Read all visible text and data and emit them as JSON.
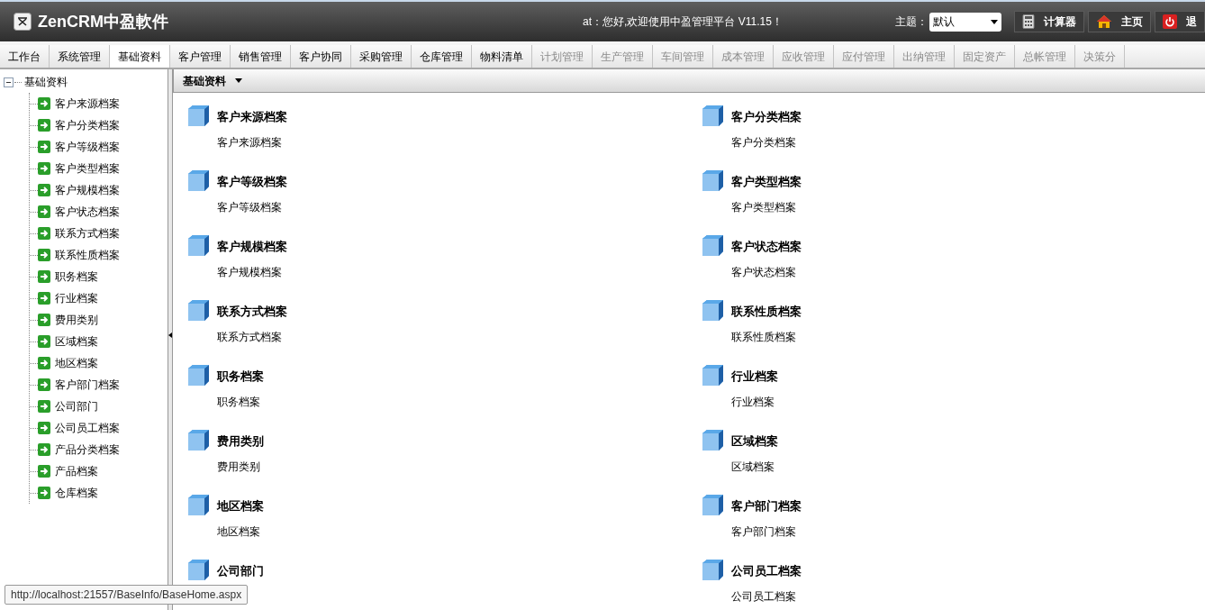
{
  "header": {
    "logo_text": "ZenCRM中盈軟件",
    "greeting": "at：您好,欢迎使用中盈管理平台 V11.15！",
    "theme": {
      "label": "主题：",
      "value": "默认"
    },
    "buttons": [
      {
        "kind": "calculator",
        "label": "计算器"
      },
      {
        "kind": "home",
        "label": "主页"
      },
      {
        "kind": "power",
        "label": "退"
      }
    ]
  },
  "tabs": [
    {
      "label": "工作台",
      "selected": false,
      "disabled": false
    },
    {
      "label": "系统管理",
      "selected": false,
      "disabled": false
    },
    {
      "label": "基础资料",
      "selected": true,
      "disabled": false
    },
    {
      "label": "客户管理",
      "selected": false,
      "disabled": false
    },
    {
      "label": "销售管理",
      "selected": false,
      "disabled": false
    },
    {
      "label": "客户协同",
      "selected": false,
      "disabled": false
    },
    {
      "label": "采购管理",
      "selected": false,
      "disabled": false
    },
    {
      "label": "仓库管理",
      "selected": false,
      "disabled": false
    },
    {
      "label": "物料清单",
      "selected": false,
      "disabled": false
    },
    {
      "label": "计划管理",
      "selected": false,
      "disabled": true
    },
    {
      "label": "生产管理",
      "selected": false,
      "disabled": true
    },
    {
      "label": "车间管理",
      "selected": false,
      "disabled": true
    },
    {
      "label": "成本管理",
      "selected": false,
      "disabled": true
    },
    {
      "label": "应收管理",
      "selected": false,
      "disabled": true
    },
    {
      "label": "应付管理",
      "selected": false,
      "disabled": true
    },
    {
      "label": "出纳管理",
      "selected": false,
      "disabled": true
    },
    {
      "label": "固定资产",
      "selected": false,
      "disabled": true
    },
    {
      "label": "总帐管理",
      "selected": false,
      "disabled": true
    },
    {
      "label": "决策分",
      "selected": false,
      "disabled": true
    }
  ],
  "sidebar": {
    "tree": [
      {
        "label": "基础资料",
        "expanded": true,
        "children": [
          {
            "label": "客户来源档案"
          },
          {
            "label": "客户分类档案"
          },
          {
            "label": "客户等级档案"
          },
          {
            "label": "客户类型档案"
          },
          {
            "label": "客户规模档案"
          },
          {
            "label": "客户状态档案"
          },
          {
            "label": "联系方式档案"
          },
          {
            "label": "联系性质档案"
          },
          {
            "label": "职务档案"
          },
          {
            "label": "行业档案"
          },
          {
            "label": "费用类别"
          },
          {
            "label": "区域档案"
          },
          {
            "label": "地区档案"
          },
          {
            "label": "客户部门档案"
          },
          {
            "label": "公司部门"
          },
          {
            "label": "公司员工档案"
          },
          {
            "label": "产品分类档案"
          },
          {
            "label": "产品档案"
          },
          {
            "label": "仓库档案"
          }
        ]
      }
    ]
  },
  "content": {
    "breadcrumb": "基础资料",
    "items": [
      {
        "title": "客户来源档案",
        "description": "客户来源档案"
      },
      {
        "title": "客户分类档案",
        "description": "客户分类档案"
      },
      {
        "title": "客户等级档案",
        "description": "客户等级档案"
      },
      {
        "title": "客户类型档案",
        "description": "客户类型档案"
      },
      {
        "title": "客户规模档案",
        "description": "客户规模档案"
      },
      {
        "title": "客户状态档案",
        "description": "客户状态档案"
      },
      {
        "title": "联系方式档案",
        "description": "联系方式档案"
      },
      {
        "title": "联系性质档案",
        "description": "联系性质档案"
      },
      {
        "title": "职务档案",
        "description": "职务档案"
      },
      {
        "title": "行业档案",
        "description": "行业档案"
      },
      {
        "title": "费用类别",
        "description": "费用类别"
      },
      {
        "title": "区域档案",
        "description": "区域档案"
      },
      {
        "title": "地区档案",
        "description": "地区档案"
      },
      {
        "title": "客户部门档案",
        "description": "客户部门档案"
      },
      {
        "title": "公司部门"
      },
      {
        "title": "公司员工档案",
        "description": "公司员工档案"
      }
    ]
  },
  "status_tooltip": "http://localhost:21557/BaseInfo/BaseHome.aspx"
}
